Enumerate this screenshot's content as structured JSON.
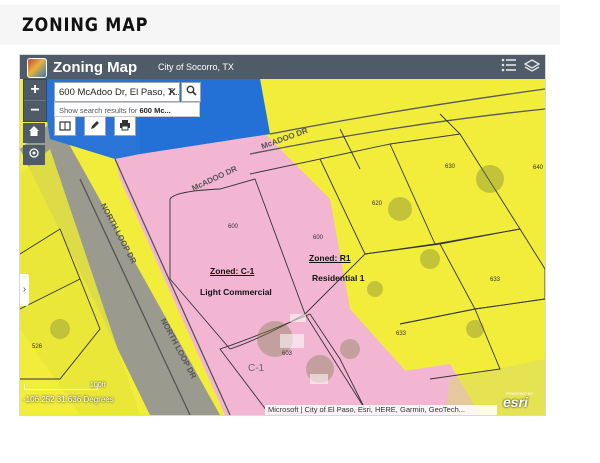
{
  "page": {
    "title": "ZONING MAP"
  },
  "app": {
    "title": "Zoning Map",
    "city": "City of Socorro, TX",
    "header_icons": [
      "list-icon",
      "layers-icon"
    ]
  },
  "map_controls": {
    "zoom_in": "+",
    "zoom_out": "−",
    "home_icon": "home-icon",
    "locate_icon": "locate-icon",
    "tool_icons": [
      "basemap-icon",
      "edit-icon",
      "print-icon"
    ],
    "side_tab": "›"
  },
  "search": {
    "value": "600 McAdoo Dr, El Paso, T...",
    "clear": "✕",
    "button_icon": "search-icon",
    "suggest_prefix": "Show search results for",
    "suggest_query": "600 Mc..."
  },
  "zones": [
    {
      "heading": "Zoned:  C-1",
      "description": "Light Commercial"
    },
    {
      "heading": "Zoned:  R1",
      "description": "Residential 1"
    }
  ],
  "streets": [
    "McADOO DR",
    "McADOO DR",
    "NORTH LOOP DR",
    "NORTH LOOP DR"
  ],
  "parcel_labels": [
    "600",
    "630",
    "620",
    "600",
    "633",
    "633",
    "603",
    "C-1",
    "526",
    "640"
  ],
  "status": {
    "coordinates": "-106.252 31.636 Degrees",
    "scale": "100ft",
    "attribution": "Microsoft | City of El Paso, Esri, HERE, Garmin, GeoTech...",
    "powered_by": "POWERED BY",
    "esri": "esri"
  },
  "colors": {
    "header": "#4f5b66",
    "commercial_pink": "#f2b6d3",
    "residential_yellow": "#f2ec3a",
    "blue_zone": "#1f6fd6"
  }
}
